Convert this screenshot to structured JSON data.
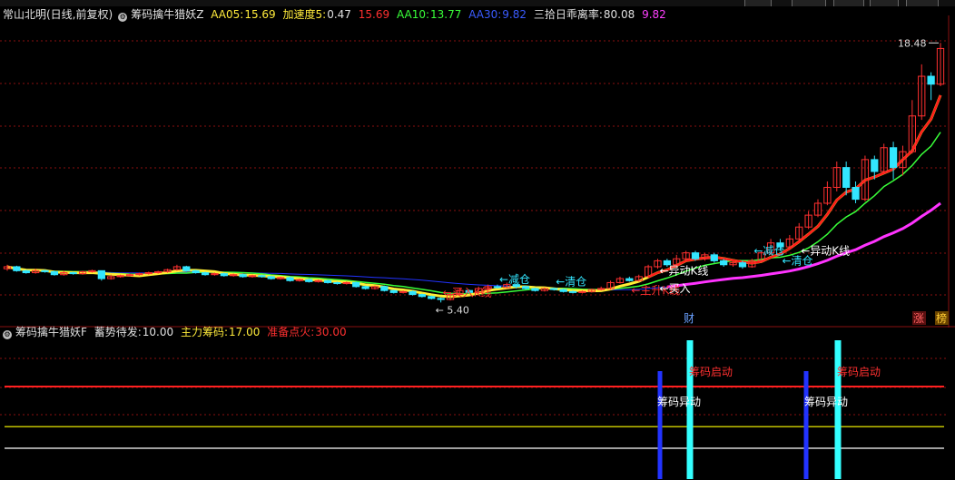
{
  "main_header": {
    "stock": "常山北明(日线,前复权)",
    "indicator": "筹码擒牛猎妖Z",
    "aa05_label": "AA05:",
    "aa05_value": "15.69",
    "accel_label": "加速度5:",
    "accel_value": "0.47",
    "accel_extra": "15.69",
    "aa10_label": "AA10:",
    "aa10_value": "13.77",
    "aa30_label": "AA30:",
    "aa30_value": "9.82",
    "dev_label": "三拾日乖离率:",
    "dev_value": "80.08",
    "dev_extra": "9.82"
  },
  "sub_header": {
    "indicator": "筹码擒牛猎妖F",
    "s1_label": "蓄势待发:",
    "s1_value": "10.00",
    "s2_label": "主力筹码:",
    "s2_value": "17.00",
    "s3_label": "准备点火:",
    "s3_value": "30.00"
  },
  "colors": {
    "up": "#ff3030",
    "down": "#33e6ff",
    "aa05": "#ff1a1a",
    "aa10": "#39ff39",
    "aa30": "#ff33ff",
    "blue": "#2233ff"
  },
  "chart_data": [
    {
      "type": "candlestick",
      "price_high_label": "18.48",
      "price_low_label": "5.40",
      "annotations": [
        "买入K线",
        "减仓",
        "清仓",
        "主升K线",
        "买入",
        "异动K线",
        "减仓",
        "清仓",
        "异动K线"
      ],
      "markers": [
        "财",
        "涨",
        "榜"
      ],
      "ylim": [
        4.5,
        19.5
      ],
      "candles": [
        [
          7.1,
          7.2,
          7.3,
          7.0
        ],
        [
          7.2,
          7.0,
          7.25,
          6.95
        ],
        [
          7.0,
          6.9,
          7.05,
          6.85
        ],
        [
          6.9,
          7.0,
          7.1,
          6.85
        ],
        [
          7.0,
          6.95,
          7.05,
          6.9
        ],
        [
          6.95,
          6.8,
          7.0,
          6.75
        ],
        [
          6.8,
          6.9,
          7.0,
          6.75
        ],
        [
          6.9,
          6.85,
          6.95,
          6.8
        ],
        [
          6.85,
          6.95,
          7.0,
          6.8
        ],
        [
          6.95,
          7.0,
          7.05,
          6.9
        ],
        [
          7.0,
          6.6,
          7.0,
          6.5
        ],
        [
          6.6,
          6.7,
          6.8,
          6.55
        ],
        [
          6.7,
          6.75,
          6.8,
          6.65
        ],
        [
          6.75,
          6.8,
          6.85,
          6.7
        ],
        [
          6.8,
          6.85,
          6.9,
          6.75
        ],
        [
          6.85,
          6.9,
          6.95,
          6.8
        ],
        [
          6.9,
          6.95,
          7.0,
          6.85
        ],
        [
          6.95,
          7.05,
          7.1,
          6.9
        ],
        [
          7.05,
          7.2,
          7.3,
          7.0
        ],
        [
          7.2,
          7.0,
          7.25,
          6.95
        ],
        [
          7.0,
          6.9,
          7.05,
          6.85
        ],
        [
          6.9,
          6.8,
          6.95,
          6.75
        ],
        [
          6.8,
          6.85,
          6.9,
          6.75
        ],
        [
          6.85,
          6.75,
          6.9,
          6.7
        ],
        [
          6.75,
          6.8,
          6.85,
          6.7
        ],
        [
          6.8,
          6.7,
          6.85,
          6.65
        ],
        [
          6.7,
          6.75,
          6.8,
          6.65
        ],
        [
          6.75,
          6.7,
          6.8,
          6.65
        ],
        [
          6.7,
          6.6,
          6.75,
          6.55
        ],
        [
          6.6,
          6.65,
          6.7,
          6.55
        ],
        [
          6.65,
          6.5,
          6.7,
          6.45
        ],
        [
          6.5,
          6.55,
          6.6,
          6.45
        ],
        [
          6.55,
          6.45,
          6.6,
          6.4
        ],
        [
          6.45,
          6.5,
          6.55,
          6.4
        ],
        [
          6.5,
          6.4,
          6.55,
          6.35
        ],
        [
          6.4,
          6.35,
          6.45,
          6.3
        ],
        [
          6.35,
          6.4,
          6.45,
          6.3
        ],
        [
          6.4,
          6.2,
          6.45,
          6.15
        ],
        [
          6.2,
          6.1,
          6.25,
          6.05
        ],
        [
          6.1,
          6.2,
          6.25,
          6.05
        ],
        [
          6.2,
          6.0,
          6.25,
          5.95
        ],
        [
          6.0,
          5.9,
          6.05,
          5.85
        ],
        [
          5.9,
          5.95,
          6.0,
          5.85
        ],
        [
          5.95,
          5.8,
          6.0,
          5.75
        ],
        [
          5.8,
          5.7,
          5.85,
          5.65
        ],
        [
          5.7,
          5.6,
          5.75,
          5.55
        ],
        [
          5.6,
          5.55,
          5.65,
          5.4
        ],
        [
          5.55,
          5.8,
          5.9,
          5.5
        ],
        [
          5.8,
          6.0,
          6.1,
          5.75
        ],
        [
          6.0,
          5.9,
          6.05,
          5.85
        ],
        [
          5.9,
          6.1,
          6.2,
          5.85
        ],
        [
          6.1,
          6.2,
          6.3,
          6.05
        ],
        [
          6.2,
          6.15,
          6.3,
          6.1
        ],
        [
          6.15,
          6.3,
          6.4,
          6.1
        ],
        [
          6.3,
          6.2,
          6.35,
          6.1
        ],
        [
          6.2,
          6.1,
          6.25,
          6.05
        ],
        [
          6.1,
          6.0,
          6.15,
          5.95
        ],
        [
          6.0,
          6.1,
          6.15,
          5.95
        ],
        [
          6.1,
          6.05,
          6.15,
          6.0
        ],
        [
          6.05,
          5.95,
          6.1,
          5.9
        ],
        [
          5.95,
          5.9,
          6.0,
          5.85
        ],
        [
          5.9,
          5.95,
          6.0,
          5.85
        ],
        [
          5.95,
          6.05,
          6.1,
          5.9
        ],
        [
          6.05,
          6.1,
          6.2,
          6.0
        ],
        [
          6.1,
          6.4,
          6.5,
          6.05
        ],
        [
          6.4,
          6.6,
          6.7,
          6.35
        ],
        [
          6.6,
          6.5,
          6.7,
          6.45
        ],
        [
          6.5,
          6.7,
          6.8,
          6.45
        ],
        [
          6.7,
          7.2,
          7.3,
          6.65
        ],
        [
          7.2,
          7.5,
          7.6,
          7.1
        ],
        [
          7.5,
          7.3,
          7.6,
          7.2
        ],
        [
          7.3,
          7.6,
          7.8,
          7.25
        ],
        [
          7.6,
          7.9,
          8.0,
          7.5
        ],
        [
          7.9,
          7.6,
          8.0,
          7.5
        ],
        [
          7.6,
          7.8,
          7.9,
          7.5
        ],
        [
          7.8,
          7.5,
          7.9,
          7.4
        ],
        [
          7.5,
          7.3,
          7.6,
          7.2
        ],
        [
          7.3,
          7.4,
          7.5,
          7.2
        ],
        [
          7.4,
          7.2,
          7.5,
          7.1
        ],
        [
          7.2,
          7.5,
          7.6,
          7.15
        ],
        [
          7.5,
          7.9,
          8.0,
          7.4
        ],
        [
          7.9,
          8.4,
          8.6,
          7.8
        ],
        [
          8.4,
          8.2,
          8.6,
          8.0
        ],
        [
          8.2,
          8.6,
          8.8,
          8.1
        ],
        [
          8.6,
          9.2,
          9.4,
          8.5
        ],
        [
          9.2,
          9.8,
          10.0,
          9.1
        ],
        [
          9.8,
          10.4,
          10.6,
          9.7
        ],
        [
          10.4,
          11.2,
          11.5,
          10.3
        ],
        [
          11.2,
          12.2,
          12.5,
          11.0
        ],
        [
          12.2,
          11.2,
          12.5,
          10.8
        ],
        [
          11.2,
          10.6,
          11.5,
          10.4
        ],
        [
          10.6,
          12.6,
          12.8,
          10.5
        ],
        [
          12.6,
          12.0,
          12.8,
          11.6
        ],
        [
          12.0,
          13.2,
          13.4,
          11.9
        ],
        [
          13.2,
          12.2,
          13.5,
          11.6
        ],
        [
          12.2,
          13.0,
          13.3,
          11.8
        ],
        [
          13.0,
          14.8,
          15.6,
          12.9
        ],
        [
          14.8,
          16.8,
          17.4,
          14.6
        ],
        [
          16.8,
          16.4,
          17.0,
          15.6
        ],
        [
          16.4,
          18.2,
          18.48,
          16.3
        ]
      ]
    },
    {
      "type": "bar",
      "series": [
        {
          "name": "蓄势待发",
          "values": [
            10.0,
            10.0
          ]
        },
        {
          "name": "主力筹码",
          "values": [
            17.0,
            17.0
          ]
        },
        {
          "name": "准备点火",
          "values": [
            30.0,
            30.0
          ]
        }
      ],
      "annotations": [
        "筹码异动",
        "筹码启动",
        "筹码异动",
        "筹码启动"
      ],
      "ylim": [
        0,
        45
      ]
    }
  ]
}
